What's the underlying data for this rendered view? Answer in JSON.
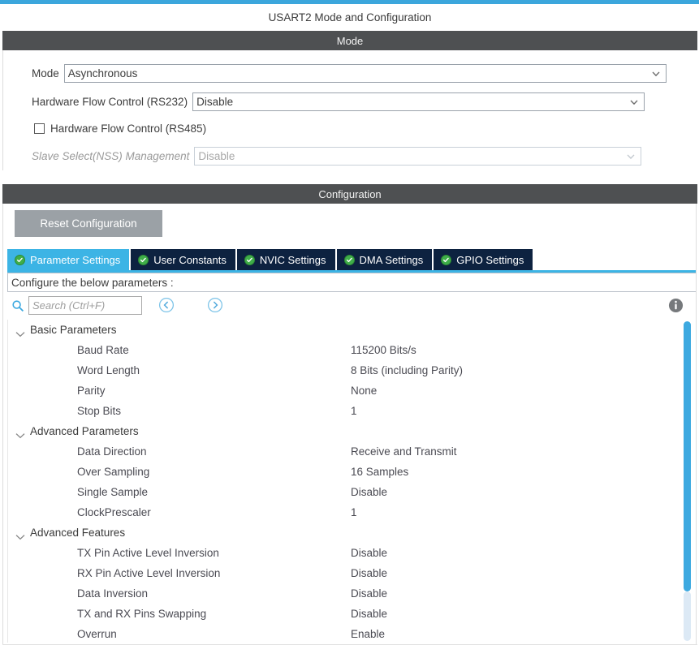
{
  "window": {
    "title": "USART2 Mode and Configuration"
  },
  "mode_section": {
    "header": "Mode",
    "mode_label": "Mode",
    "mode_value": "Asynchronous",
    "hwfc_rs232_label": "Hardware Flow Control (RS232)",
    "hwfc_rs232_value": "Disable",
    "hwfc_rs485_label": "Hardware Flow Control (RS485)",
    "hwfc_rs485_checked": false,
    "nss_label": "Slave Select(NSS) Management",
    "nss_value": "Disable",
    "nss_enabled": false
  },
  "configuration_section": {
    "header": "Configuration",
    "reset_button": "Reset Configuration",
    "tabs": [
      {
        "label": "Parameter Settings",
        "active": true,
        "icon": "check-circle-icon"
      },
      {
        "label": "User Constants",
        "active": false,
        "icon": "check-circle-icon"
      },
      {
        "label": "NVIC Settings",
        "active": false,
        "icon": "check-circle-icon"
      },
      {
        "label": "DMA Settings",
        "active": false,
        "icon": "check-circle-icon"
      },
      {
        "label": "GPIO Settings",
        "active": false,
        "icon": "check-circle-icon"
      }
    ],
    "instruction": "Configure the below parameters :",
    "search_placeholder": "Search (Ctrl+F)",
    "search_value": "",
    "nav_prev_icon": "chevron-left-circle-icon",
    "nav_next_icon": "chevron-right-circle-icon",
    "info_icon": "info-icon",
    "search_icon": "search-icon"
  },
  "parameters": [
    {
      "type": "group",
      "name": "Basic Parameters",
      "expanded": true
    },
    {
      "type": "param",
      "name": "Baud Rate",
      "value": "115200 Bits/s"
    },
    {
      "type": "param",
      "name": "Word Length",
      "value": "8 Bits (including Parity)"
    },
    {
      "type": "param",
      "name": "Parity",
      "value": "None"
    },
    {
      "type": "param",
      "name": "Stop Bits",
      "value": "1"
    },
    {
      "type": "group",
      "name": "Advanced Parameters",
      "expanded": true
    },
    {
      "type": "param",
      "name": "Data Direction",
      "value": "Receive and Transmit"
    },
    {
      "type": "param",
      "name": "Over Sampling",
      "value": "16 Samples"
    },
    {
      "type": "param",
      "name": "Single Sample",
      "value": "Disable"
    },
    {
      "type": "param",
      "name": "ClockPrescaler",
      "value": "1"
    },
    {
      "type": "group",
      "name": "Advanced Features",
      "expanded": true
    },
    {
      "type": "param",
      "name": "TX Pin Active Level Inversion",
      "value": "Disable"
    },
    {
      "type": "param",
      "name": "RX Pin Active Level Inversion",
      "value": "Disable"
    },
    {
      "type": "param",
      "name": "Data Inversion",
      "value": "Disable"
    },
    {
      "type": "param",
      "name": "TX and RX Pins Swapping",
      "value": "Disable"
    },
    {
      "type": "param",
      "name": "Overrun",
      "value": "Enable"
    }
  ],
  "colors": {
    "accent_blue": "#3BA6DC",
    "tab_active": "#3CB4E5",
    "tab_inactive": "#0D2240",
    "header_bar": "#4E5052",
    "check_green": "#3FAE49",
    "scrollbar": "#3DA9E0",
    "reset_button": "#9BA1A6"
  }
}
